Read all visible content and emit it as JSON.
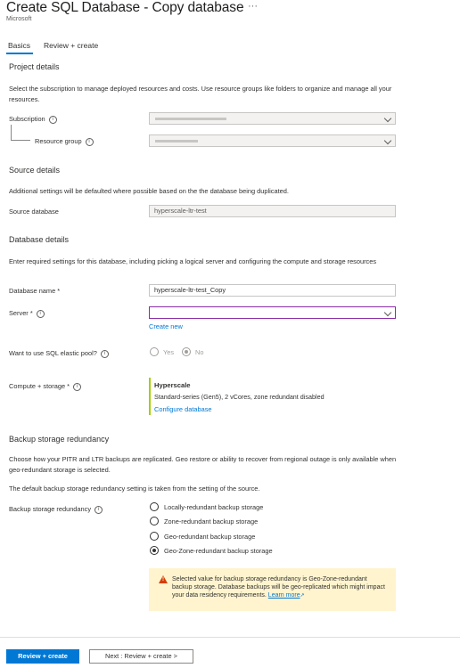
{
  "header": {
    "title": "Create SQL Database - Copy database",
    "ellipsis": "···",
    "subtitle": "Microsoft"
  },
  "tabs": [
    {
      "label": "Basics"
    },
    {
      "label": "Review + create"
    }
  ],
  "project": {
    "heading": "Project details",
    "description": "Select the subscription to manage deployed resources and costs. Use resource groups like folders to organize and manage all your resources.",
    "subscription_label": "Subscription",
    "resource_group_label": "Resource group"
  },
  "source": {
    "heading": "Source details",
    "description": "Additional settings will be defaulted where possible based on the the database being duplicated.",
    "source_db_label": "Source database",
    "source_db_value": "hyperscale-ltr-test"
  },
  "database": {
    "heading": "Database details",
    "description": "Enter required settings for this database, including picking a logical server and configuring the compute and storage resources",
    "name_label": "Database name *",
    "name_value": "hyperscale-ltr-test_Copy",
    "server_label": "Server *",
    "server_value": "",
    "create_new": "Create new",
    "elastic_label": "Want to use SQL elastic pool?",
    "elastic_yes": "Yes",
    "elastic_no": "No",
    "compute_label": "Compute + storage *",
    "compute_tier": "Hyperscale",
    "compute_desc": "Standard-series (Gen5), 2 vCores, zone redundant disabled",
    "configure_link": "Configure database"
  },
  "backup": {
    "heading": "Backup storage redundancy",
    "description1": "Choose how your PITR and LTR backups are replicated. Geo restore or ability to recover from regional outage is only available when geo-redundant storage is selected.",
    "description2": "The default backup storage redundancy setting is taken from the setting of the source.",
    "label": "Backup storage redundancy",
    "options": [
      {
        "label": "Locally-redundant backup storage"
      },
      {
        "label": "Zone-redundant backup storage"
      },
      {
        "label": "Geo-redundant backup storage"
      },
      {
        "label": "Geo-Zone-redundant backup storage"
      }
    ],
    "selected_index": 3,
    "warning": "Selected value for backup storage redundancy is Geo-Zone-redundant backup storage. Database backups will be geo-replicated which might impact your data residency requirements.",
    "learn_more": "Learn more"
  },
  "footer": {
    "primary": "Review + create",
    "secondary": "Next : Review + create >"
  },
  "colors": {
    "accent": "#0078d4",
    "focus": "#8a2da5",
    "compute_bar": "#a4cf0c",
    "warning_bg": "#fff4ce",
    "warning_icon": "#d83b01"
  }
}
